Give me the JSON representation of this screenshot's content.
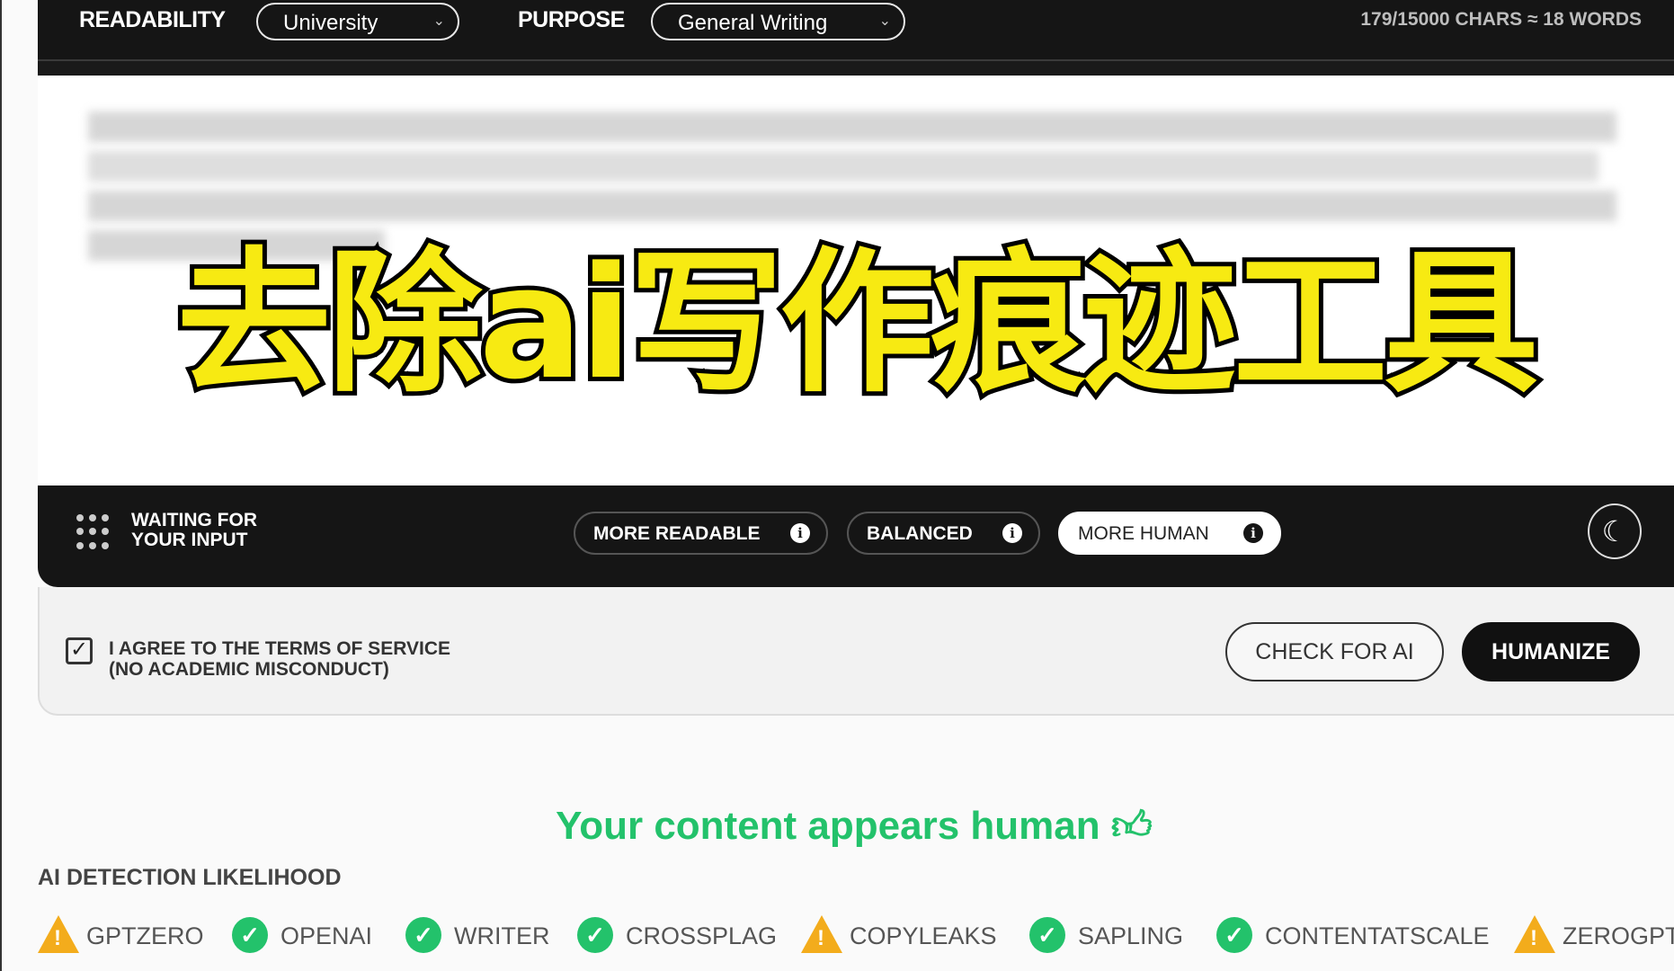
{
  "toolbar": {
    "readability_label": "READABILITY",
    "readability_value": "University",
    "purpose_label": "PURPOSE",
    "purpose_value": "General Writing",
    "char_count": "179/15000 CHARS ≈ 18 WORDS"
  },
  "overlay_title": "去除ai写作痕迹工具",
  "status": {
    "line1": "WAITING FOR",
    "line2": "YOUR INPUT"
  },
  "modes": [
    {
      "label": "MORE READABLE",
      "active": false
    },
    {
      "label": "BALANCED",
      "active": false
    },
    {
      "label": "MORE HUMAN",
      "active": true
    }
  ],
  "terms": {
    "line1": "I AGREE TO THE TERMS OF SERVICE",
    "line2": "(NO ACADEMIC MISCONDUCT)",
    "checked": true
  },
  "buttons": {
    "check": "CHECK FOR AI",
    "humanize": "HUMANIZE"
  },
  "result": {
    "verdict": "Your content appears human",
    "color": "#23c26b"
  },
  "detection": {
    "title": "AI DETECTION LIKELIHOOD",
    "detectors": [
      {
        "name": "GPTZERO",
        "status": "warning"
      },
      {
        "name": "OPENAI",
        "status": "pass"
      },
      {
        "name": "WRITER",
        "status": "pass"
      },
      {
        "name": "CROSSPLAG",
        "status": "pass"
      },
      {
        "name": "COPYLEAKS",
        "status": "warning"
      },
      {
        "name": "SAPLING",
        "status": "pass"
      },
      {
        "name": "CONTENTATSCALE",
        "status": "pass"
      },
      {
        "name": "ZEROGPT",
        "status": "warning"
      }
    ]
  }
}
